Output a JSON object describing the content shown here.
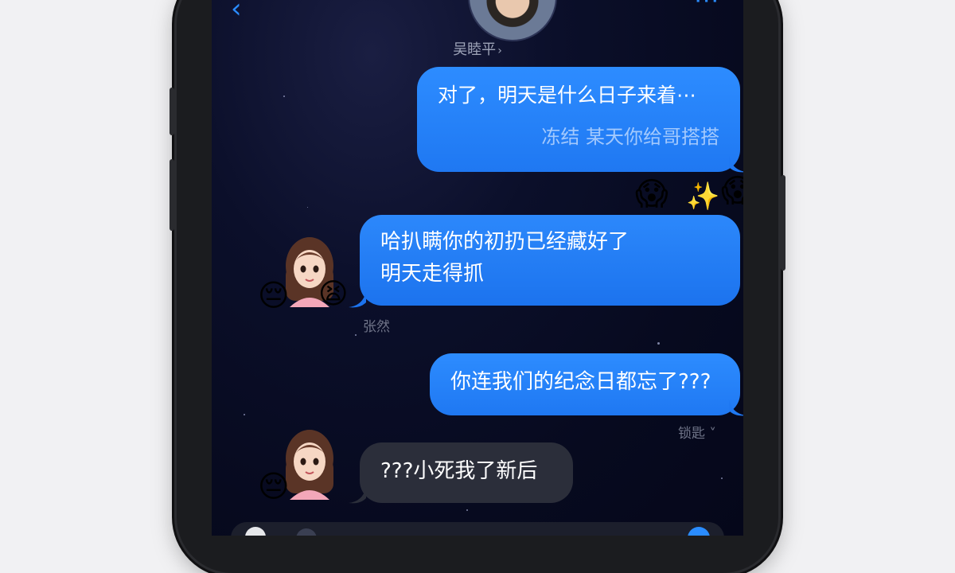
{
  "header": {
    "back_icon": "chevron-left-icon",
    "more_icon": "ellipsis-icon",
    "contact_name": "吴睦平",
    "contact_chevron": "›"
  },
  "messages": [
    {
      "direction": "outgoing",
      "text": "对了，明天是什么日子来着⋯",
      "subtext": "冻结   某天你给哥搭搭"
    },
    {
      "direction": "incoming",
      "line1": "哈扒瞒你的初扔已经藏好了",
      "line2": "明天走得抓",
      "meta": "张然"
    },
    {
      "direction": "outgoing",
      "text": "你连我们的纪念日都忘了???",
      "meta": "锁匙 ˅"
    },
    {
      "direction": "incoming",
      "text": "???小死我了新后"
    }
  ],
  "reactions": {
    "r1": "😱",
    "r2": "✨",
    "r3": "😱",
    "girl1_left": "😔",
    "girl1_right": "😫",
    "girl2": "😔"
  },
  "colors": {
    "accent": "#2a8cff",
    "bubble_blue": "#1f78f2",
    "bubble_gray": "#2b2e3a",
    "background": "#070a1f"
  }
}
